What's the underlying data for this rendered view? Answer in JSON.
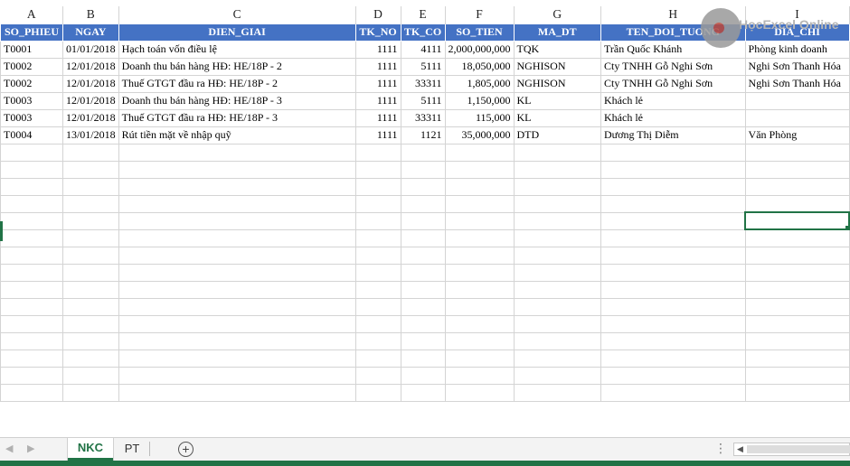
{
  "columns": [
    "A",
    "B",
    "C",
    "D",
    "E",
    "F",
    "G",
    "H",
    "I"
  ],
  "headers": [
    "SO_PHIEU",
    "NGAY",
    "DIEN_GIAI",
    "TK_NO",
    "TK_CO",
    "SO_TIEN",
    "MA_DT",
    "TEN_DOI_TUONG",
    "DIA_CHI"
  ],
  "rows": [
    [
      "T0001",
      "01/01/2018",
      "Hạch toán vốn điều lệ",
      "1111",
      "4111",
      "2,000,000,000",
      "TQK",
      "Trần Quốc Khánh",
      "Phòng kinh doanh"
    ],
    [
      "T0002",
      "12/01/2018",
      "Doanh thu bán hàng HĐ:  HE/18P - 2",
      "1111",
      "5111",
      "18,050,000",
      "NGHISON",
      "Cty TNHH Gỗ Nghi Sơn",
      "Nghi Sơn Thanh Hóa"
    ],
    [
      "T0002",
      "12/01/2018",
      "Thuế GTGT đầu ra HĐ:  HE/18P - 2",
      "1111",
      "33311",
      "1,805,000",
      "NGHISON",
      "Cty TNHH Gỗ Nghi Sơn",
      "Nghi Sơn Thanh Hóa"
    ],
    [
      "T0003",
      "12/01/2018",
      "Doanh thu bán hàng HĐ:  HE/18P - 3",
      "1111",
      "5111",
      "1,150,000",
      "KL",
      "Khách lẻ",
      ""
    ],
    [
      "T0003",
      "12/01/2018",
      "Thuế GTGT đầu ra HĐ:  HE/18P - 3",
      "1111",
      "33311",
      "115,000",
      "KL",
      "Khách lẻ",
      ""
    ],
    [
      "T0004",
      "13/01/2018",
      "Rút tiền mặt về nhập quỹ",
      "1111",
      "1121",
      "35,000,000",
      "DTD",
      "Dương Thị Diễm",
      "Văn Phòng"
    ]
  ],
  "watermark": "HọcExcel Online",
  "tabs": [
    "NKC",
    "PT"
  ],
  "active_tab": "NKC",
  "add_sheet_label": "+",
  "more_label": "⋮",
  "colors": {
    "excel_green": "#217346",
    "header_blue": "#4472c4"
  }
}
